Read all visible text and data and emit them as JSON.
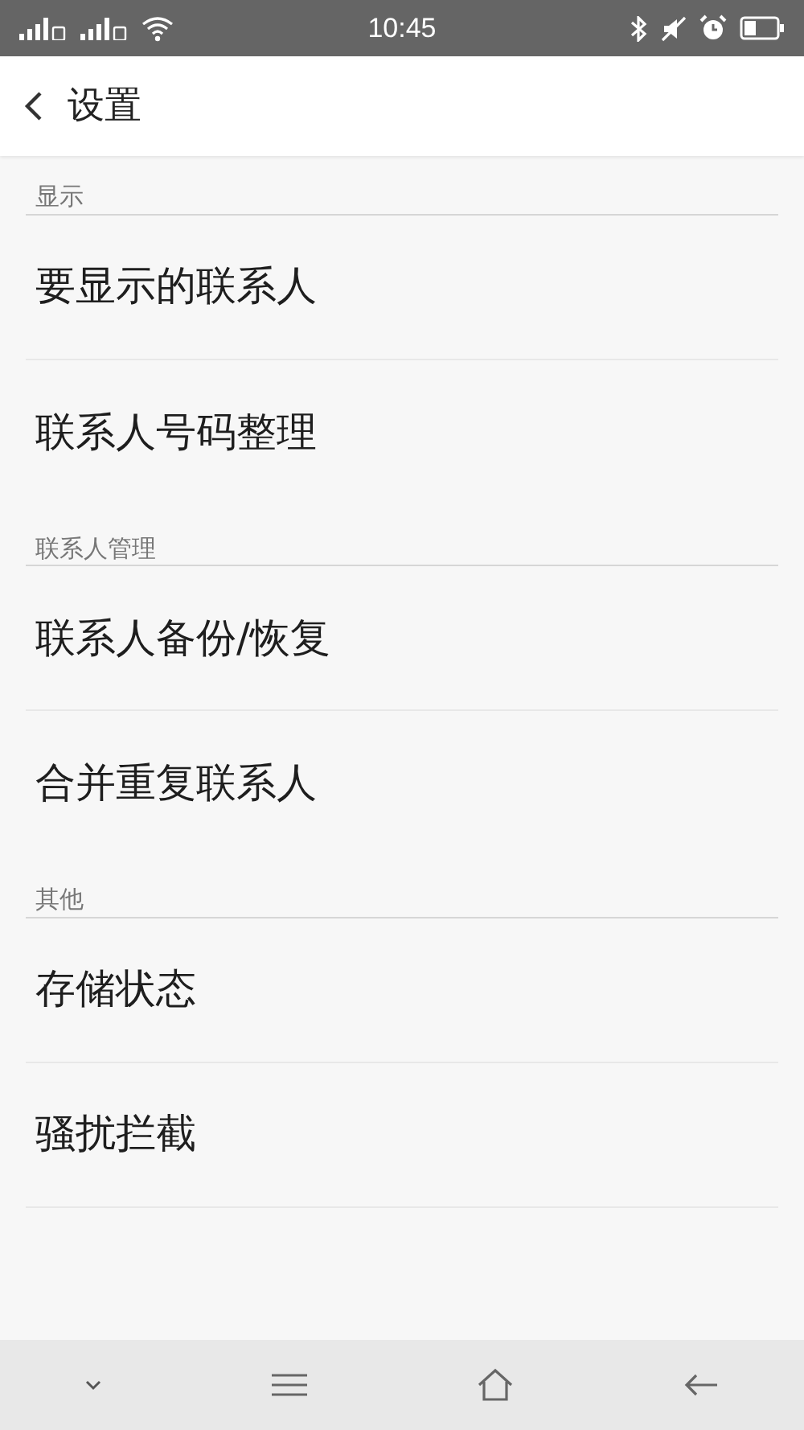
{
  "status_bar": {
    "time": "10:45"
  },
  "header": {
    "title": "设置"
  },
  "sections": [
    {
      "title": "显示",
      "items": [
        {
          "label": "要显示的联系人"
        },
        {
          "label": "联系人号码整理"
        }
      ]
    },
    {
      "title": "联系人管理",
      "items": [
        {
          "label": "联系人备份/恢复"
        },
        {
          "label": "合并重复联系人"
        }
      ]
    },
    {
      "title": "其他",
      "items": [
        {
          "label": "存储状态"
        },
        {
          "label": "骚扰拦截"
        }
      ]
    }
  ]
}
